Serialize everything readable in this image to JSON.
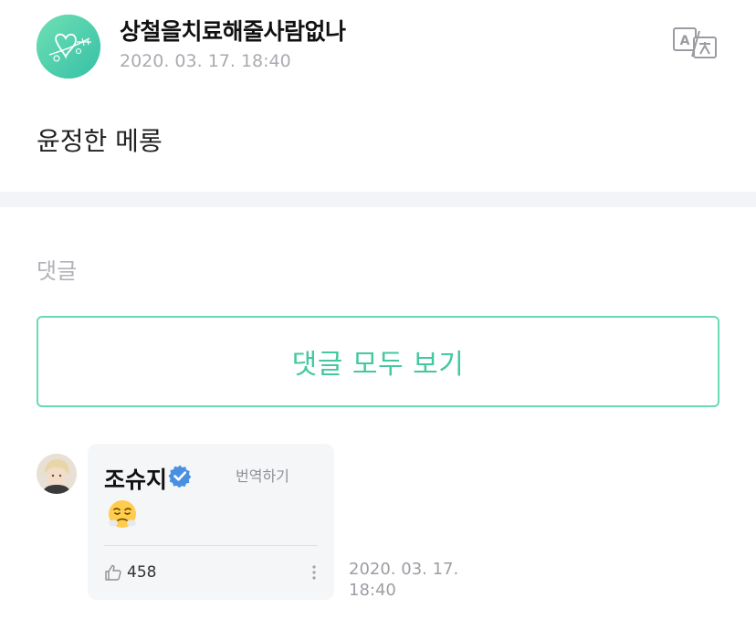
{
  "post": {
    "author": "상철을치료해줄사람없나",
    "date": "2020. 03. 17. 18:40",
    "body": "윤정한 메롱",
    "avatar": "mint-heart-avatar",
    "translate_icon": "translate-icon"
  },
  "comments_section": {
    "heading": "댓글",
    "view_all_label": "댓글 모두 보기"
  },
  "comment": {
    "author": "조슈지",
    "verified_icon": "verified-badge-icon",
    "translate_label": "번역하기",
    "emoji": "steam-from-nose-face",
    "likes": "458",
    "like_icon": "thumbs-up-icon",
    "more_icon": "more-vertical-icon",
    "date": "2020. 03. 17. 18:40"
  },
  "colors": {
    "accent": "#43c89f",
    "accent_border": "#6ad9b6",
    "divider_band": "#f3f4f7",
    "card_bg": "#f5f6f8",
    "muted_text": "#a9abb1",
    "verified": "#4a90e2"
  }
}
